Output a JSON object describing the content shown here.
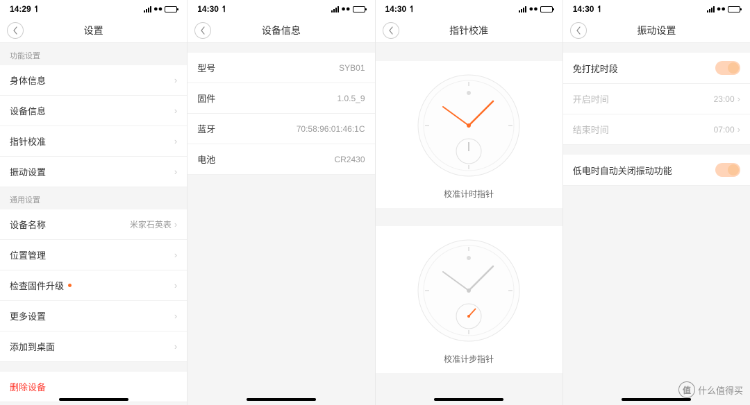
{
  "screens": [
    {
      "time": "14:29",
      "title": "设置",
      "sections": [
        {
          "header": "功能设置",
          "items": [
            {
              "label": "身体信息",
              "chevron": true
            },
            {
              "label": "设备信息",
              "chevron": true
            },
            {
              "label": "指针校准",
              "chevron": true
            },
            {
              "label": "振动设置",
              "chevron": true
            }
          ]
        },
        {
          "header": "通用设置",
          "items": [
            {
              "label": "设备名称",
              "value": "米家石英表",
              "chevron": true
            },
            {
              "label": "位置管理",
              "chevron": true
            },
            {
              "label": "检查固件升级",
              "dot": true,
              "chevron": true
            },
            {
              "label": "更多设置",
              "chevron": true
            },
            {
              "label": "添加到桌面",
              "chevron": true
            }
          ]
        },
        {
          "items": [
            {
              "label": "删除设备",
              "danger": true
            }
          ]
        }
      ]
    },
    {
      "time": "14:30",
      "title": "设备信息",
      "info": [
        {
          "label": "型号",
          "value": "SYB01"
        },
        {
          "label": "固件",
          "value": "1.0.5_9"
        },
        {
          "label": "蓝牙",
          "value": "70:58:96:01:46:1C"
        },
        {
          "label": "电池",
          "value": "CR2430"
        }
      ]
    },
    {
      "time": "14:30",
      "title": "指针校准",
      "clocks": [
        {
          "label": "校准计时指针",
          "type": "time"
        },
        {
          "label": "校准计步指针",
          "type": "step"
        }
      ]
    },
    {
      "time": "14:30",
      "title": "振动设置",
      "groups": [
        {
          "items": [
            {
              "label": "免打扰时段",
              "toggle": true
            },
            {
              "label": "开启时间",
              "value": "23:00",
              "chevron": true,
              "muted": true
            },
            {
              "label": "结束时间",
              "value": "07:00",
              "chevron": true,
              "muted": true
            }
          ]
        },
        {
          "items": [
            {
              "label": "低电时自动关闭振动功能",
              "toggle": true
            }
          ]
        }
      ]
    }
  ],
  "watermark": "什么值得买"
}
